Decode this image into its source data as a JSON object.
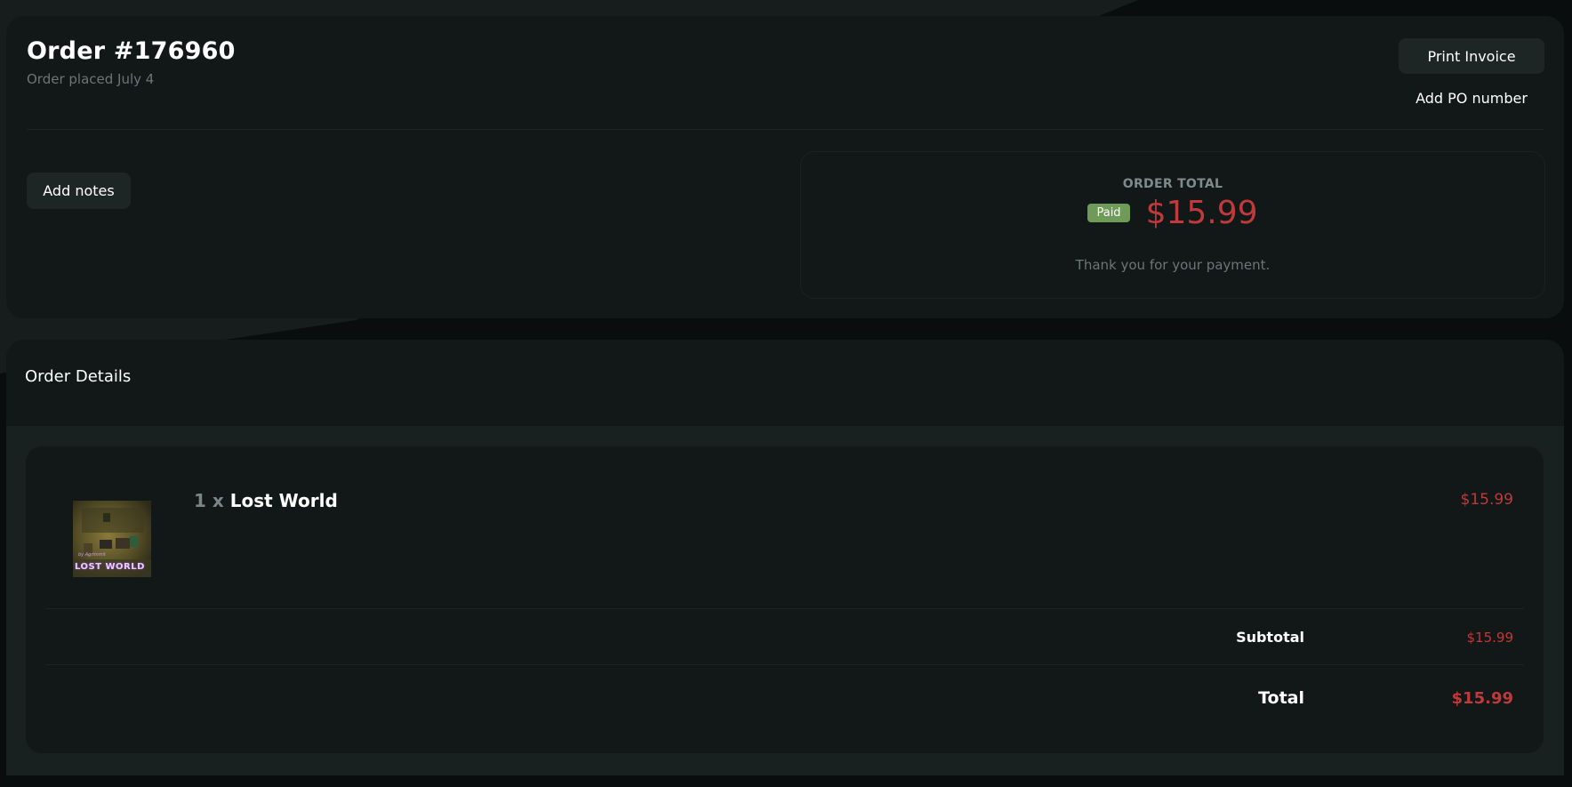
{
  "order": {
    "title": "Order #176960",
    "placed": "Order placed July 4"
  },
  "actions": {
    "print_invoice": "Print Invoice",
    "add_po": "Add PO number",
    "add_notes": "Add notes"
  },
  "summary": {
    "label": "ORDER TOTAL",
    "status_badge": "Paid",
    "amount": "$15.99",
    "message": "Thank you for your payment."
  },
  "details": {
    "title": "Order Details",
    "items": [
      {
        "quantity": "1 x",
        "name": "Lost World",
        "price": "$15.99",
        "thumbnail_text": "LOST WORLD"
      }
    ],
    "subtotal_label": "Subtotal",
    "subtotal_value": "$15.99",
    "total_label": "Total",
    "total_value": "$15.99"
  },
  "colors": {
    "accent_price": "#c0393b",
    "paid_badge": "#6e9b57",
    "card_bg": "#121717",
    "page_bg": "#0a0d0d"
  }
}
